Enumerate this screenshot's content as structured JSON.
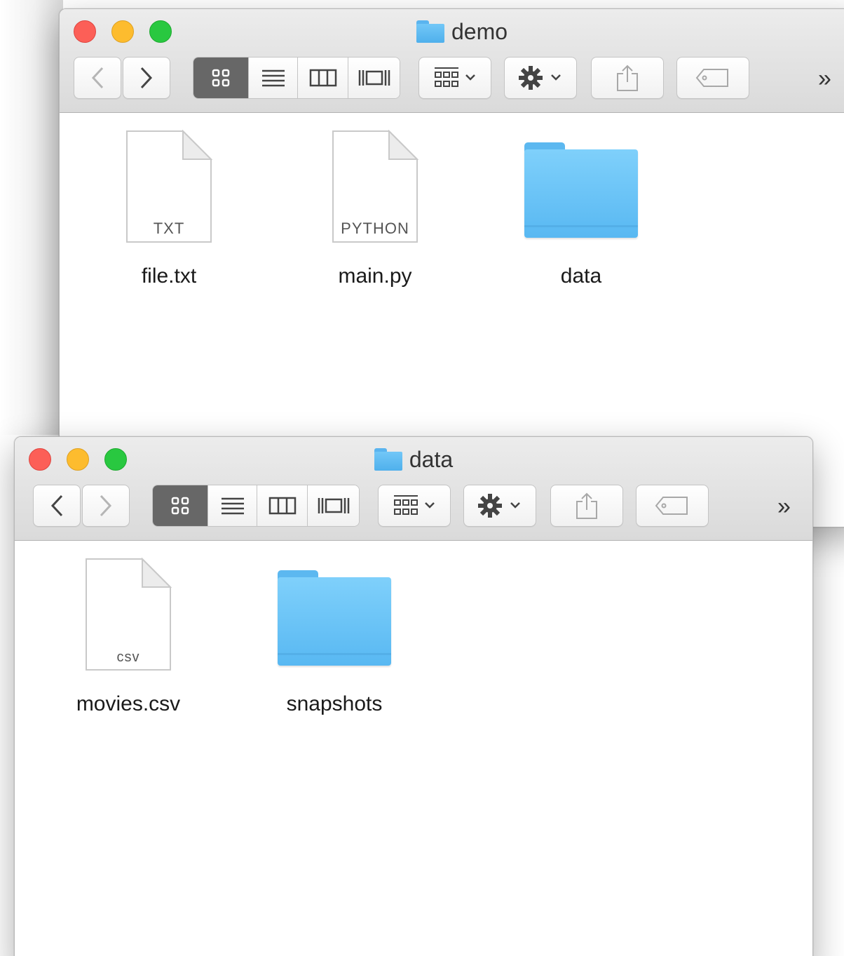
{
  "windows": {
    "demo": {
      "title": "demo",
      "overflow": "»",
      "items": [
        {
          "name": "file.txt",
          "kind": "document",
          "ext": "TXT"
        },
        {
          "name": "main.py",
          "kind": "document",
          "ext": "PYTHON"
        },
        {
          "name": "data",
          "kind": "folder"
        }
      ]
    },
    "data": {
      "title": "data",
      "overflow": "»",
      "items": [
        {
          "name": "movies.csv",
          "kind": "document",
          "ext": "CSV"
        },
        {
          "name": "snapshots",
          "kind": "folder"
        }
      ]
    }
  },
  "toolbar": {
    "view_modes": [
      "icon-view",
      "list-view",
      "column-view",
      "cover-flow-view"
    ],
    "active_view": "icon-view",
    "icons": [
      "back-arrow-icon",
      "forward-arrow-icon",
      "arrange-icon",
      "gear-icon",
      "share-icon",
      "tag-icon"
    ]
  },
  "colors": {
    "close": "#fc5f57",
    "minimize": "#fdbc2e",
    "zoom": "#29c840",
    "folder": "#6cc4f7",
    "active_segment": "#676767"
  }
}
